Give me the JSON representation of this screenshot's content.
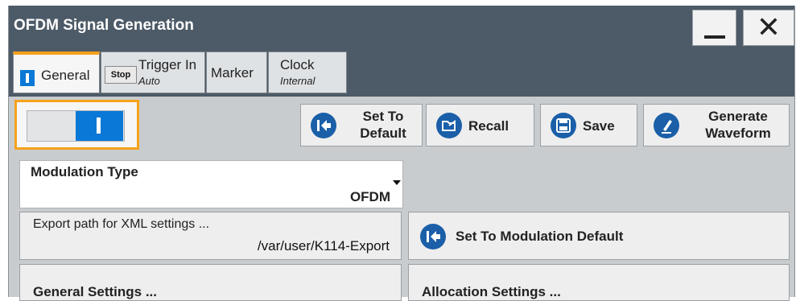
{
  "window": {
    "title": "OFDM Signal Generation",
    "close_glyph": "✕"
  },
  "tabs": [
    {
      "label": "General",
      "sub": ""
    },
    {
      "label": "Trigger In",
      "sub": "Auto",
      "badge": "Stop"
    },
    {
      "label": "Marker",
      "sub": ""
    },
    {
      "label": "Clock",
      "sub": "Internal"
    }
  ],
  "toolbar": {
    "state_toggle": "on",
    "set_default": [
      "Set To",
      "Default"
    ],
    "recall": "Recall",
    "save": "Save",
    "generate": [
      "Generate",
      "Waveform"
    ]
  },
  "modulation": {
    "label": "Modulation Type",
    "value": "OFDM"
  },
  "export": {
    "label": "Export path for XML settings ...",
    "value": "/var/user/K114-Export"
  },
  "mod_default_label": "Set To Modulation Default",
  "general_settings_label": "General Settings ...",
  "allocation_settings_label": "Allocation Settings ...",
  "colors": {
    "accent": "#f5a21b",
    "titlebar": "#4d5a67",
    "icon_blue": "#1a5fa8",
    "toggle_blue": "#0a78d6"
  }
}
